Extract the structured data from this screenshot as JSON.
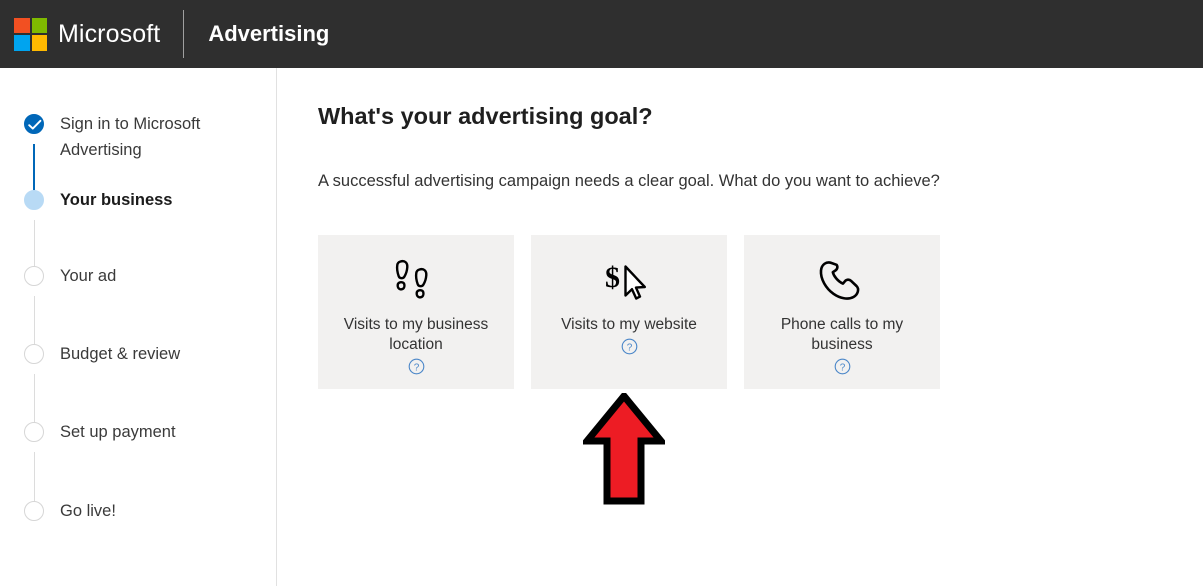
{
  "header": {
    "logo_icon": "microsoft-squares-logo",
    "brand": "Microsoft",
    "product": "Advertising",
    "logo_colors": {
      "red": "#f25022",
      "green": "#7fba00",
      "blue": "#00a4ef",
      "yellow": "#ffb900"
    },
    "background": "#2f2f2f"
  },
  "sidebar": {
    "steps": [
      {
        "label": "Sign in to Microsoft Advertising",
        "state": "completed",
        "icon": "check-icon"
      },
      {
        "label": "Your business",
        "state": "current",
        "icon": "filled-dot-icon"
      },
      {
        "label": "Your ad",
        "state": "upcoming",
        "icon": "empty-circle-icon"
      },
      {
        "label": "Budget & review",
        "state": "upcoming",
        "icon": "empty-circle-icon"
      },
      {
        "label": "Set up payment",
        "state": "upcoming",
        "icon": "empty-circle-icon"
      },
      {
        "label": "Go live!",
        "state": "upcoming",
        "icon": "empty-circle-icon"
      }
    ],
    "accent_color": "#0067b8",
    "current_color": "#b8daf5"
  },
  "main": {
    "title": "What's your advertising goal?",
    "subtitle": "A successful advertising campaign needs a clear goal. What do you want to achieve?",
    "goals": [
      {
        "label": "Visits to my business location",
        "icon": "footsteps-icon",
        "help_icon": "question-circle-icon"
      },
      {
        "label": "Visits to my website",
        "icon": "dollar-cursor-icon",
        "help_icon": "question-circle-icon"
      },
      {
        "label": "Phone calls to my business",
        "icon": "phone-handset-icon",
        "help_icon": "question-circle-icon"
      }
    ],
    "card_background": "#f2f1f0"
  },
  "annotation": {
    "icon": "red-up-arrow-annotation",
    "color": "#ed1c24",
    "outline": "#000000",
    "points_at": "Visits to my website"
  }
}
